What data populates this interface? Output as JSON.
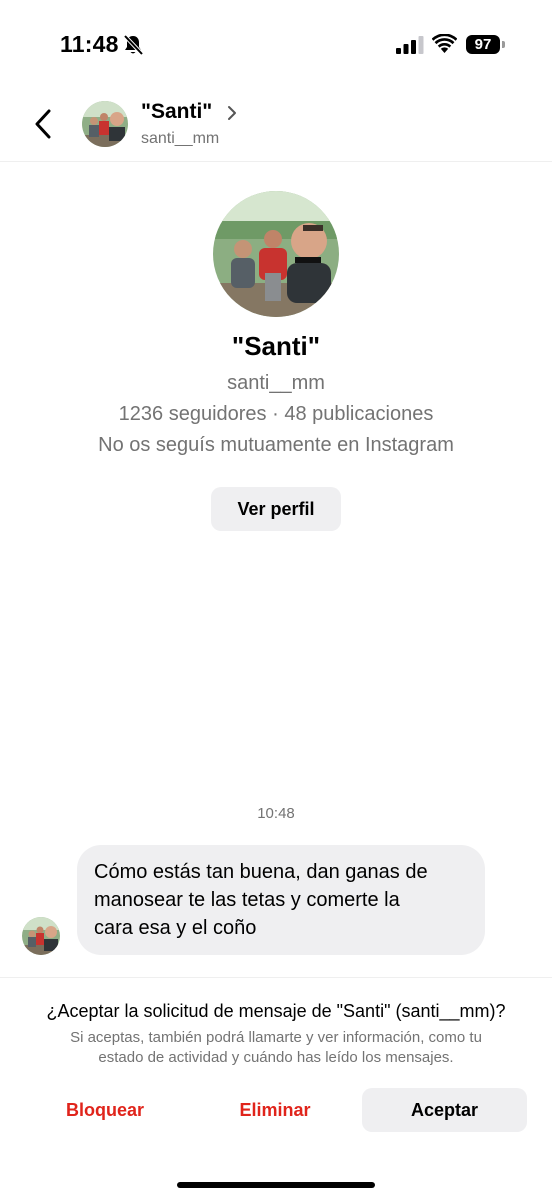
{
  "status_bar": {
    "time": "11:48",
    "battery": "97",
    "icons": [
      "bell-slash-icon",
      "signal-icon",
      "wifi-icon",
      "battery-icon"
    ]
  },
  "header": {
    "name": "\"Santi\"",
    "username": "santi__mm",
    "icons": [
      "chevron-left-icon",
      "chevron-right-icon"
    ]
  },
  "profile": {
    "name": "\"Santi\"",
    "username": "santi__mm",
    "stats": "1236 seguidores · 48 publicaciones",
    "mutual": "No os seguís mutuamente en Instagram",
    "view_profile_label": "Ver perfil"
  },
  "conversation": {
    "timestamp": "10:48",
    "messages": [
      {
        "text_lines": [
          "Cómo estás tan buena, dan ganas de",
          "manosear te las tetas y comerte la",
          "cara esa y el coño"
        ]
      }
    ]
  },
  "request": {
    "title": "¿Aceptar la solicitud de mensaje de \"Santi\" (santi__mm)?",
    "info_lines": [
      "Si aceptas, también podrá llamarte y ver información, como tu",
      "estado de actividad y cuándo has leído los mensajes."
    ],
    "block_label": "Bloquear",
    "delete_label": "Eliminar",
    "accept_label": "Aceptar"
  },
  "colors": {
    "danger": "#e0241b",
    "secondary_text": "#737373",
    "button_bg": "#efeff1"
  }
}
